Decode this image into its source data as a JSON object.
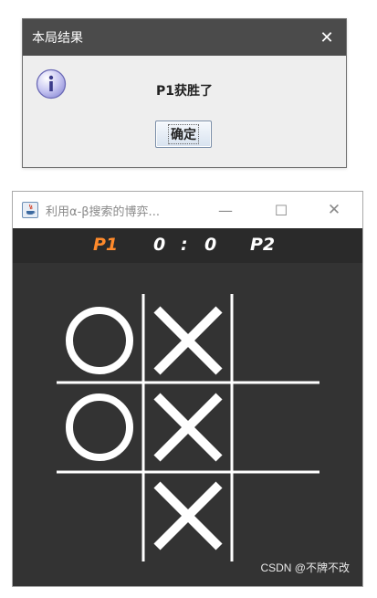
{
  "dialog": {
    "title": "本局结果",
    "message": "P1获胜了",
    "ok_label": "确定"
  },
  "game_window": {
    "title": "利用α-β搜索的博弈...",
    "min_glyph": "—",
    "max_glyph": "☐",
    "close_glyph": "✕"
  },
  "score": {
    "p1_label": "P1",
    "p1_score": "0",
    "separator": ":",
    "p2_score": "0",
    "p2_label": "P2"
  },
  "board": {
    "cells": [
      "O",
      "X",
      "",
      "O",
      "X",
      "",
      "",
      "X",
      ""
    ]
  },
  "watermark": "CSDN @不牌不改",
  "colors": {
    "p1_accent": "#ff8a2b",
    "board_bg": "#333333",
    "mark": "#ffffff"
  }
}
